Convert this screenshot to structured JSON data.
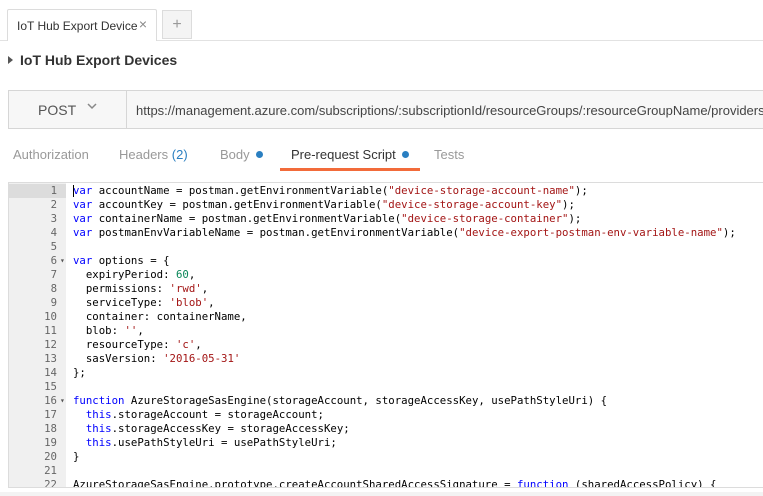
{
  "tabs": [
    {
      "label": "IoT Hub Export Device",
      "close": "×"
    }
  ],
  "add_tab": "+",
  "collection_title": "IoT Hub Export Devices",
  "request": {
    "method": "POST",
    "url": "https://management.azure.com/subscriptions/:subscriptionId/resourceGroups/:resourceGroupName/providers/"
  },
  "request_tabs": {
    "authorization": "Authorization",
    "headers": "Headers",
    "headers_count": "(2)",
    "body": "Body",
    "prerequest": "Pre-request Script",
    "tests": "Tests"
  },
  "editor": {
    "lines": [
      {
        "n": "1",
        "t": [
          [
            "kw",
            "var"
          ],
          [
            "p",
            " accountName = postman.getEnvironmentVariable("
          ],
          [
            "str",
            "\"device-storage-account-name\""
          ],
          [
            "p",
            ");"
          ]
        ]
      },
      {
        "n": "2",
        "t": [
          [
            "kw",
            "var"
          ],
          [
            "p",
            " accountKey = postman.getEnvironmentVariable("
          ],
          [
            "str",
            "\"device-storage-account-key\""
          ],
          [
            "p",
            ");"
          ]
        ]
      },
      {
        "n": "3",
        "t": [
          [
            "kw",
            "var"
          ],
          [
            "p",
            " containerName = postman.getEnvironmentVariable("
          ],
          [
            "str",
            "\"device-storage-container\""
          ],
          [
            "p",
            ");"
          ]
        ]
      },
      {
        "n": "4",
        "t": [
          [
            "kw",
            "var"
          ],
          [
            "p",
            " postmanEnvVariableName = postman.getEnvironmentVariable("
          ],
          [
            "str",
            "\"device-export-postman-env-variable-name\""
          ],
          [
            "p",
            ");"
          ]
        ]
      },
      {
        "n": "5",
        "t": []
      },
      {
        "n": "6",
        "fold": true,
        "t": [
          [
            "kw",
            "var"
          ],
          [
            "p",
            " options = {"
          ]
        ]
      },
      {
        "n": "7",
        "t": [
          [
            "p",
            "  expiryPeriod: "
          ],
          [
            "num",
            "60"
          ],
          [
            "p",
            ","
          ]
        ]
      },
      {
        "n": "8",
        "t": [
          [
            "p",
            "  permissions: "
          ],
          [
            "str",
            "'rwd'"
          ],
          [
            "p",
            ","
          ]
        ]
      },
      {
        "n": "9",
        "t": [
          [
            "p",
            "  serviceType: "
          ],
          [
            "str",
            "'blob'"
          ],
          [
            "p",
            ","
          ]
        ]
      },
      {
        "n": "10",
        "t": [
          [
            "p",
            "  container: containerName,"
          ]
        ]
      },
      {
        "n": "11",
        "t": [
          [
            "p",
            "  blob: "
          ],
          [
            "str",
            "''"
          ],
          [
            "p",
            ","
          ]
        ]
      },
      {
        "n": "12",
        "t": [
          [
            "p",
            "  resourceType: "
          ],
          [
            "str",
            "'c'"
          ],
          [
            "p",
            ","
          ]
        ]
      },
      {
        "n": "13",
        "t": [
          [
            "p",
            "  sasVersion: "
          ],
          [
            "str",
            "'2016-05-31'"
          ]
        ]
      },
      {
        "n": "14",
        "t": [
          [
            "p",
            "};"
          ]
        ]
      },
      {
        "n": "15",
        "t": []
      },
      {
        "n": "16",
        "fold": true,
        "t": [
          [
            "kw",
            "function"
          ],
          [
            "p",
            " AzureStorageSasEngine(storageAccount, storageAccessKey, usePathStyleUri) {"
          ]
        ]
      },
      {
        "n": "17",
        "t": [
          [
            "p",
            "  "
          ],
          [
            "kw",
            "this"
          ],
          [
            "p",
            ".storageAccount = storageAccount;"
          ]
        ]
      },
      {
        "n": "18",
        "t": [
          [
            "p",
            "  "
          ],
          [
            "kw",
            "this"
          ],
          [
            "p",
            ".storageAccessKey = storageAccessKey;"
          ]
        ]
      },
      {
        "n": "19",
        "t": [
          [
            "p",
            "  "
          ],
          [
            "kw",
            "this"
          ],
          [
            "p",
            ".usePathStyleUri = usePathStyleUri;"
          ]
        ]
      },
      {
        "n": "20",
        "t": [
          [
            "p",
            "}"
          ]
        ]
      },
      {
        "n": "21",
        "t": []
      },
      {
        "n": "22",
        "t": [
          [
            "p",
            "AzureStorageSasEngine.prototype.createAccountSharedAccessSignature = "
          ],
          [
            "kw",
            "function"
          ],
          [
            "p",
            " (sharedAccessPolicy) {"
          ]
        ]
      }
    ]
  },
  "colors": {
    "accent": "#f26b3a",
    "link": "#2a7fc1",
    "keyword": "#0000ff",
    "string": "#a31515",
    "number": "#098658"
  }
}
